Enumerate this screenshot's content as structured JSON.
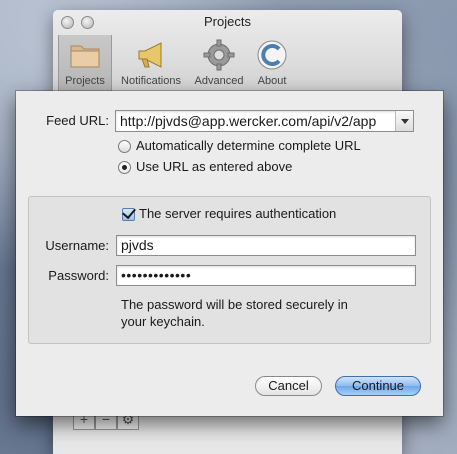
{
  "window": {
    "title": "Projects",
    "toolbar": [
      {
        "label": "Projects",
        "icon": "folder-icon"
      },
      {
        "label": "Notifications",
        "icon": "megaphone-icon"
      },
      {
        "label": "Advanced",
        "icon": "gear-icon"
      },
      {
        "label": "About",
        "icon": "about-icon"
      }
    ],
    "bottom_buttons": {
      "add": "+",
      "remove": "−"
    }
  },
  "sheet": {
    "feed_url_label": "Feed URL:",
    "feed_url_value": "http://pjvds@app.wercker.com/api/v2/app",
    "radio_auto_label": "Automatically determine complete URL",
    "radio_auto_selected": false,
    "radio_asis_label": "Use URL as entered above",
    "radio_asis_selected": true,
    "auth_checkbox_label": "The server requires authentication",
    "auth_checked": true,
    "username_label": "Username:",
    "username_value": "pjvds",
    "password_label": "Password:",
    "password_value": "•••••••••••••",
    "keychain_note_line1": "The password will be stored securely in",
    "keychain_note_line2": "your keychain.",
    "cancel_label": "Cancel",
    "continue_label": "Continue"
  },
  "colors": {
    "default_button": "#8ebcef",
    "checkbox": "#9ec1ea"
  }
}
